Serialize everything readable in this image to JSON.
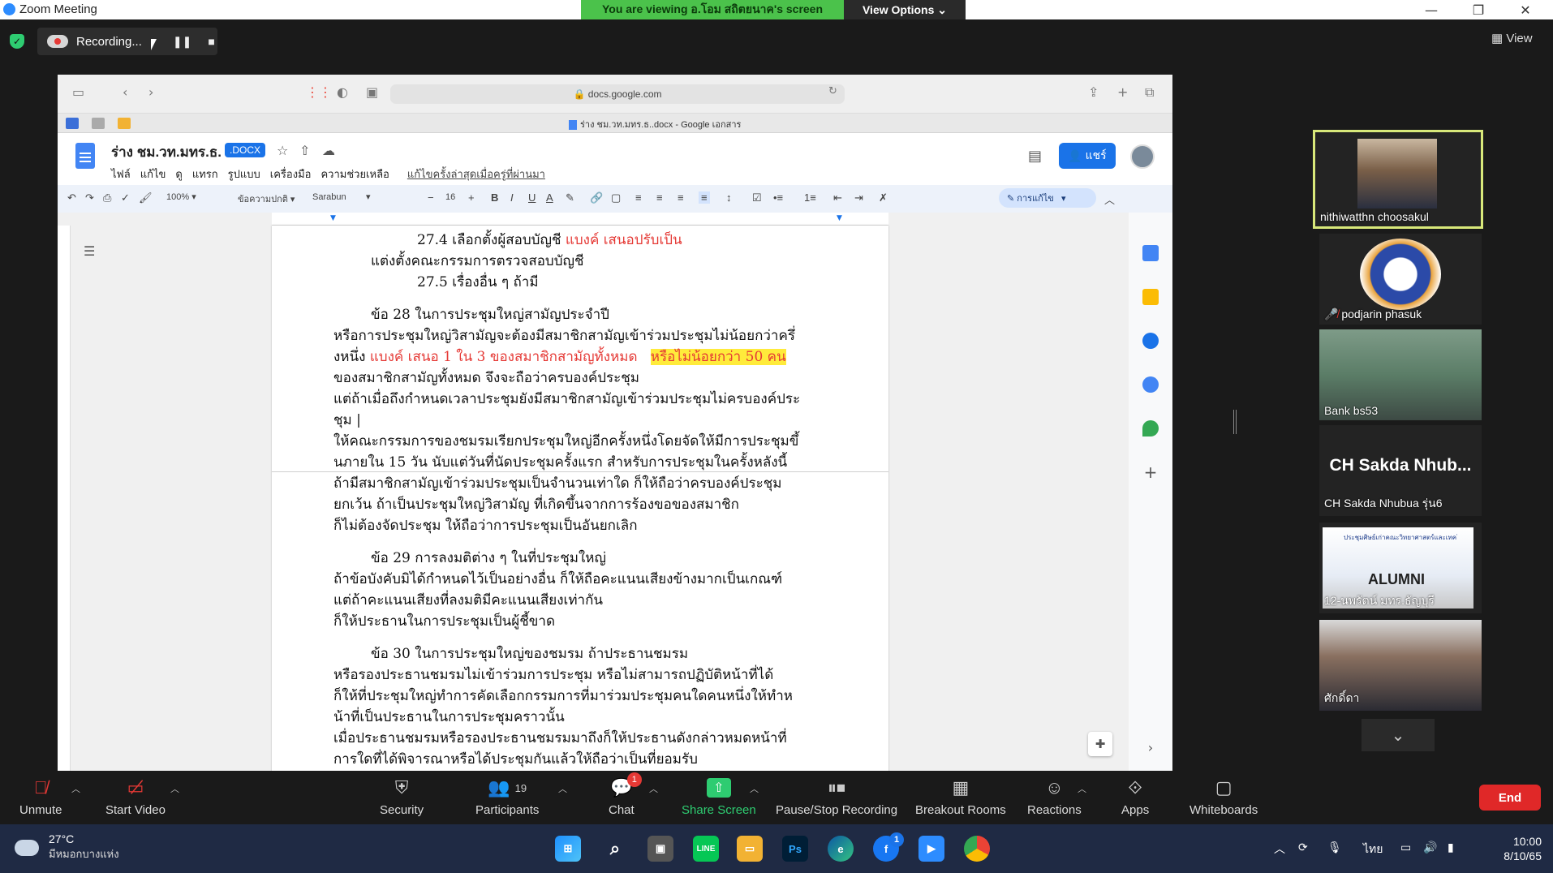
{
  "window": {
    "title": "Zoom Meeting"
  },
  "banner": {
    "viewing": "You are viewing อ.โอม สถิตยนาค's screen",
    "view_options": "View Options ⌄"
  },
  "recording": {
    "label": "Recording..."
  },
  "top_right": {
    "view_label": "View"
  },
  "browser": {
    "url": "docs.google.com",
    "tab_title": "ร่าง ชม.วท.มทร.ธ..docx - Google เอกสาร"
  },
  "docs": {
    "title": "ร่าง ชม.วท.มทร.ธ.",
    "badge": ".DOCX",
    "menu": [
      "ไฟล์",
      "แก้ไข",
      "ดู",
      "แทรก",
      "รูปแบบ",
      "เครื่องมือ",
      "ความช่วยเหลือ"
    ],
    "last_edit": "แก้ไขครั้งล่าสุดเมื่อครู่ที่ผ่านมา",
    "share_label": "แชร์",
    "zoom": "100%",
    "style": "ข้อความปกติ",
    "font": "Sarabun",
    "font_size": "16",
    "mode": "การแก้ไข"
  },
  "document": {
    "l1a": "27.4 เลือกตั้งผู้สอบบัญชี ",
    "l1b": "แบงค์ เสนอปรับเป็น",
    "l2": "แต่งตั้งคณะกรรมการตรวจสอบบัญชี",
    "l3": "27.5 เรื่องอื่น ๆ ถ้ามี",
    "l4": "ข้อ                28                   ในการประชุมใหญ่สามัญประจำปี",
    "l5": "หรือการประชุมใหญ่วิสามัญจะต้องมีสมาชิกสามัญเข้าร่วมประชุมไม่น้อยกว่าครึ่",
    "l6a": "งหนึ่ง ",
    "l6b": "แบงค์ เสนอ 1 ใน 3 ของสมาชิกสามัญทั้งหมด",
    "l6c": "หรือไม่น้อยกว่า 50 คน",
    "l7": "ของสมาชิกสามัญทั้งหมด                         จึงจะถือว่าครบองค์ประชุม",
    "l8": "แต่ถ้าเมื่อถึงกำหนดเวลาประชุมยังมีสมาชิกสามัญเข้าร่วมประชุมไม่ครบองค์ประ",
    "l9": "ชุม |",
    "l10": "ให้คณะกรรมการของชมรมเรียกประชุมใหญ่อีกครั้งหนึ่งโดยจัดให้มีการประชุมขึ้",
    "l11": "นภายใน 15 วัน นับแต่วันที่นัดประชุมครั้งแรก สำหรับการประชุมในครั้งหลังนี้",
    "l12": "ถ้ามีสมาชิกสามัญเข้าร่วมประชุมเป็นจำนวนเท่าใด      ก็ให้ถือว่าครบองค์ประชุม",
    "l13": "ยกเว้น        ถ้าเป็นประชุมใหญ่วิสามัญ        ที่เกิดขึ้นจากการร้องขอของสมาชิก",
    "l14": "ก็ไม่ต้องจัดประชุม ให้ถือว่าการประชุมเป็นอันยกเลิก",
    "l15": "ข้อ 29 การลงมติต่าง ๆ ในที่ประชุมใหญ่",
    "l16": "ถ้าข้อบังคับมิได้กำหนดไว้เป็นอย่างอื่น ก็ให้ถือคะแนนเสียงข้างมากเป็นเกณฑ์",
    "l17": "แต่ถ้าคะแนนเสียงที่ลงมติมีคะแนนเสียงเท่ากัน",
    "l18": "ก็ให้ประธานในการประชุมเป็นผู้ชี้ขาด",
    "l19": "ข้อ        30        ในการประชุมใหญ่ของชมรม        ถ้าประธานชมรม",
    "l20": "หรือรองประธานชมรมไม่เข้าร่วมการประชุม        หรือไม่สามารถปฏิบัติหน้าที่ได้",
    "l21": "ก็ให้ที่ประชุมใหญ่ทำการคัดเลือกกรรมการที่มาร่วมประชุมคนใดคนหนึ่งให้ทำห",
    "l22": "น้าที่เป็นประธานในการประชุมคราวนั้น",
    "l23": "เมื่อประธานชมรมหรือรองประธานชมรมมาถึงก็ให้ประธานดังกล่าวหมดหน้าที่",
    "l24": "การใดที่ได้พิจารณาหรือได้ประชุมกันแล้วให้ถือว่าเป็นที่ยอมรับ"
  },
  "participants": [
    {
      "name": "nithiwatthn choosakul",
      "type": "video"
    },
    {
      "name": "podjarin phasuk",
      "type": "logo"
    },
    {
      "name": "Bank bs53",
      "type": "video"
    },
    {
      "name": "CH Sakda Nhubua รุ่น6",
      "display": "CH Sakda Nhub...",
      "type": "name"
    },
    {
      "name": "12-นพรัตน์ มทร.ธัญบุรี",
      "banner_title": "ประชุมศิษย์เก่าคณะวิทยาศาสตร์และเทคโนโลยี",
      "banner_word": "ALUMNI",
      "type": "video"
    },
    {
      "name": "ศักดิ์ดา",
      "type": "video"
    }
  ],
  "toolbar": {
    "unmute": "Unmute",
    "start_video": "Start Video",
    "security": "Security",
    "participants": "Participants",
    "participants_count": "19",
    "chat": "Chat",
    "chat_badge": "1",
    "share_screen": "Share Screen",
    "pause_recording": "Pause/Stop Recording",
    "breakout": "Breakout Rooms",
    "reactions": "Reactions",
    "apps": "Apps",
    "whiteboards": "Whiteboards",
    "end": "End"
  },
  "taskbar": {
    "temp": "27°C",
    "place": "มีหมอกบางแห่ง",
    "lang": "ไทย",
    "time": "10:00",
    "date": "8/10/65",
    "facebook_badge": "1"
  },
  "colors": {
    "zoom_green": "#4bc24b",
    "end_red": "#e02828",
    "docs_blue": "#1a73e8",
    "active_tile": "#d8e87a",
    "edit_red": "#e53935",
    "highlight": "#ffeb3b"
  }
}
